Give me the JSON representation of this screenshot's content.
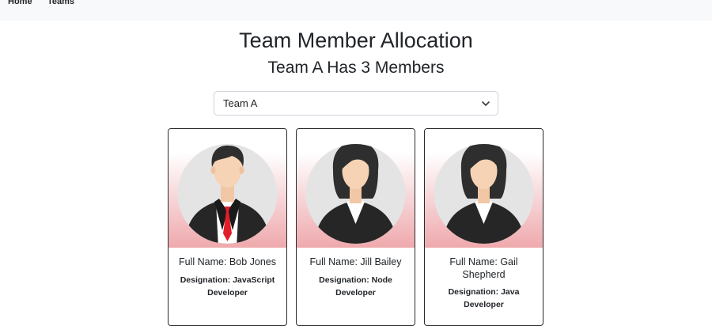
{
  "nav": {
    "home_label": "Home",
    "teams_label": "Teams"
  },
  "page": {
    "title": "Team Member Allocation",
    "subtitle": "Team A Has 3 Members"
  },
  "team_select": {
    "selected": "Team A",
    "icon": "chevron-down-icon"
  },
  "members": [
    {
      "full_name": "Full Name: Bob Jones",
      "designation": "Designation: JavaScript Developer",
      "avatar": "male-avatar"
    },
    {
      "full_name": "Full Name: Jill Bailey",
      "designation": "Designation: Node Developer",
      "avatar": "female-avatar"
    },
    {
      "full_name": "Full Name: Gail Shepherd",
      "designation": "Designation: Java Developer",
      "avatar": "female-avatar"
    }
  ],
  "colors": {
    "navbar_bg": "#f8f9fa",
    "card_gradient_end": "#efa9ad",
    "tie": "#e11d2a",
    "suit": "#262626"
  }
}
